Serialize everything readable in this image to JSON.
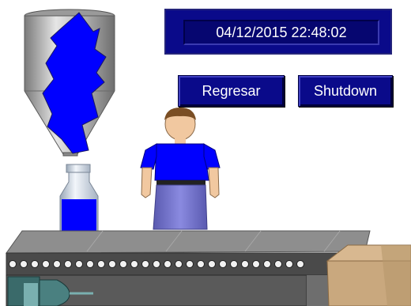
{
  "header": {
    "datetime": "04/12/2015 22:48:02"
  },
  "buttons": {
    "back_label": "Regresar",
    "shutdown_label": "Shutdown"
  },
  "process": {
    "hopper_fill_color": "#0000ff",
    "bottle_fill_color": "#0000ff"
  },
  "colors": {
    "panel_bg": "#0a0a8a",
    "text": "#ffffff"
  }
}
